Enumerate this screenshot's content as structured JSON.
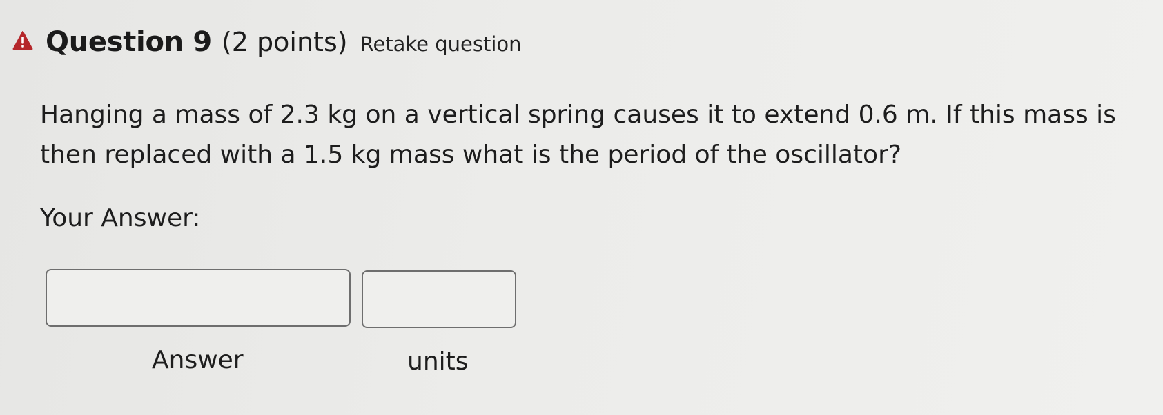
{
  "question": {
    "title": "Question 9",
    "points": "(2 points)",
    "retake_link": "Retake question",
    "warning_icon": "warning-triangle-icon",
    "warning_color": "#b5272b",
    "text": "Hanging a mass of 2.3 kg on a vertical spring causes it to extend 0.6 m. If this mass is then replaced with a 1.5 kg mass what is the period of the oscillator?"
  },
  "answer_section": {
    "prompt": "Your Answer:",
    "answer_field": {
      "value": "",
      "label": "Answer"
    },
    "units_field": {
      "value": "",
      "label": "units"
    }
  }
}
